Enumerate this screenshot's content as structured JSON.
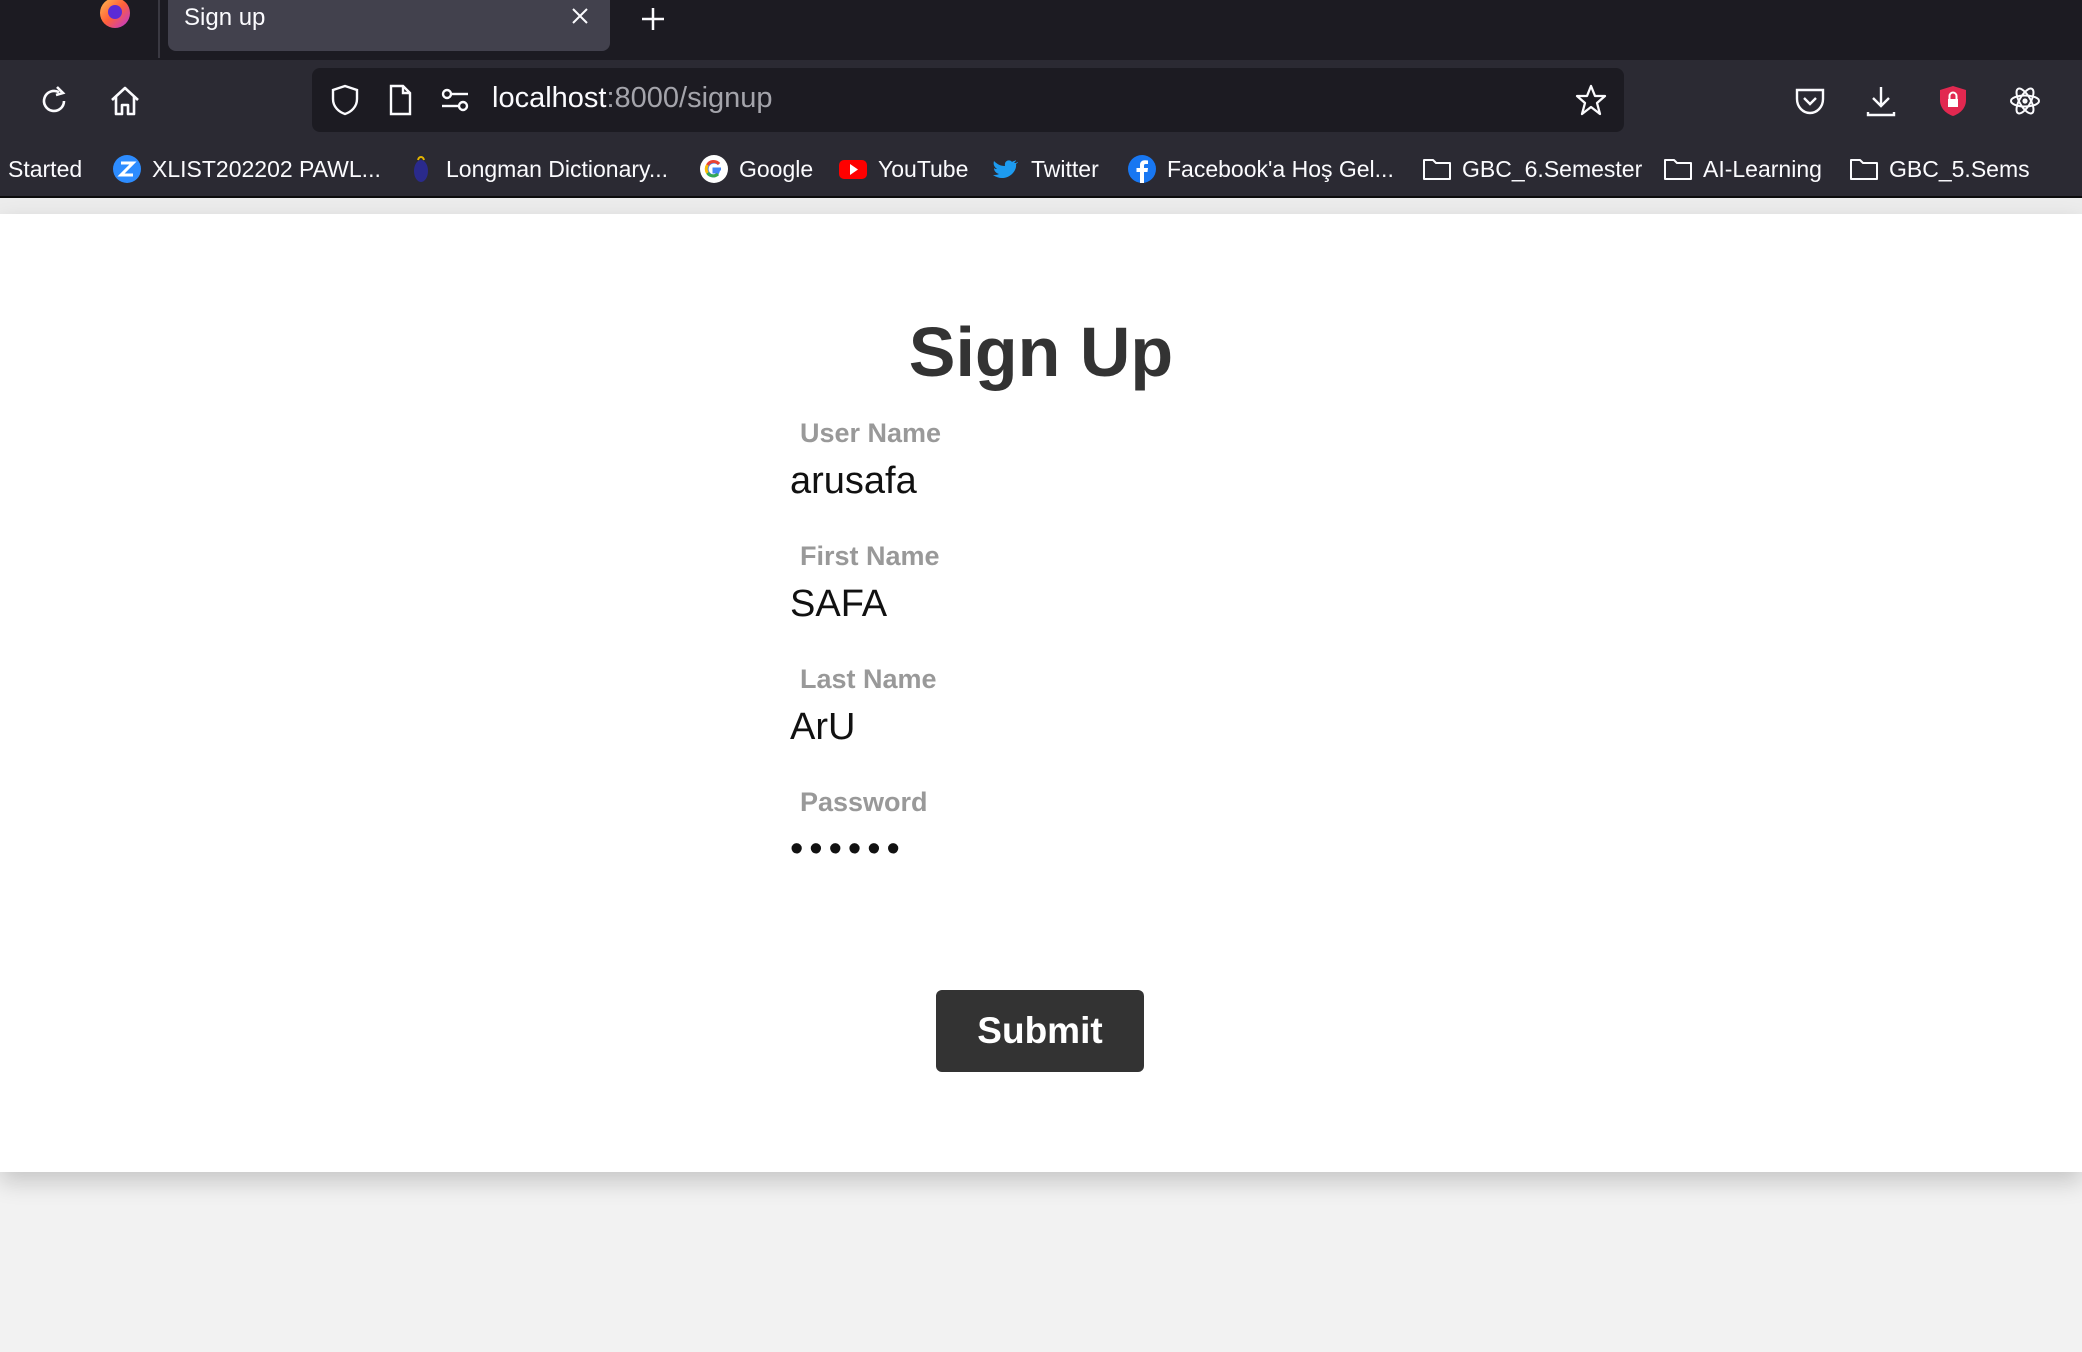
{
  "browser": {
    "tab": {
      "title": "Sign up"
    },
    "url": {
      "host": "localhost",
      "path": ":8000/signup"
    },
    "bookmarks": [
      {
        "label": "Started",
        "icon": "none"
      },
      {
        "label": "XLIST202202 PAWL...",
        "icon": "zoom-icon"
      },
      {
        "label": "Longman Dictionary...",
        "icon": "longman-icon"
      },
      {
        "label": "Google",
        "icon": "google-icon"
      },
      {
        "label": "YouTube",
        "icon": "youtube-icon"
      },
      {
        "label": "Twitter",
        "icon": "twitter-icon"
      },
      {
        "label": "Facebook'a Hoş Gel...",
        "icon": "facebook-icon"
      },
      {
        "label": "GBC_6.Semester",
        "icon": "folder-icon"
      },
      {
        "label": "AI-Learning",
        "icon": "folder-icon"
      },
      {
        "label": "GBC_5.Sems",
        "icon": "folder-icon"
      }
    ]
  },
  "form": {
    "title": "Sign Up",
    "fields": [
      {
        "label": "User Name",
        "value": "arusafa"
      },
      {
        "label": "First Name",
        "value": "SAFA"
      },
      {
        "label": "Last Name",
        "value": "ArU"
      },
      {
        "label": "Password",
        "value": "••••••"
      }
    ],
    "submit_label": "Submit"
  },
  "colors": {
    "toolbar": "#2b2a33",
    "tabstrip": "#1c1b22",
    "button": "#333333",
    "label": "#999999"
  }
}
